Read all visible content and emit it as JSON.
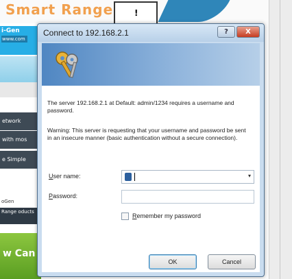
{
  "background": {
    "header_text": "Smart Range",
    "logo_text": "i-Gen",
    "logo_tag": "www.com",
    "nav_items": [
      "etwork",
      "with mos",
      "e Simple"
    ],
    "small_text": "oGen",
    "promo_text": "Range oducts",
    "green_text": "w Can",
    "icon_label": "!"
  },
  "dialog": {
    "title": "Connect to 192.168.2.1",
    "help_button": "?",
    "close_button": "X",
    "message": "The server 192.168.2.1 at Default: admin/1234 requires a username and password.",
    "warning": "Warning: This server is requesting that your username and password be sent in an insecure manner (basic authentication without a secure connection).",
    "username_label_u": "U",
    "username_label_rest": "ser name:",
    "username_value": "",
    "password_label_u": "P",
    "password_label_rest": "assword:",
    "password_value": "",
    "remember_label_u": "R",
    "remember_label_rest": "emember my password",
    "remember_checked": false,
    "ok_label": "OK",
    "cancel_label": "Cancel",
    "dropdown_arrow": "▾"
  }
}
